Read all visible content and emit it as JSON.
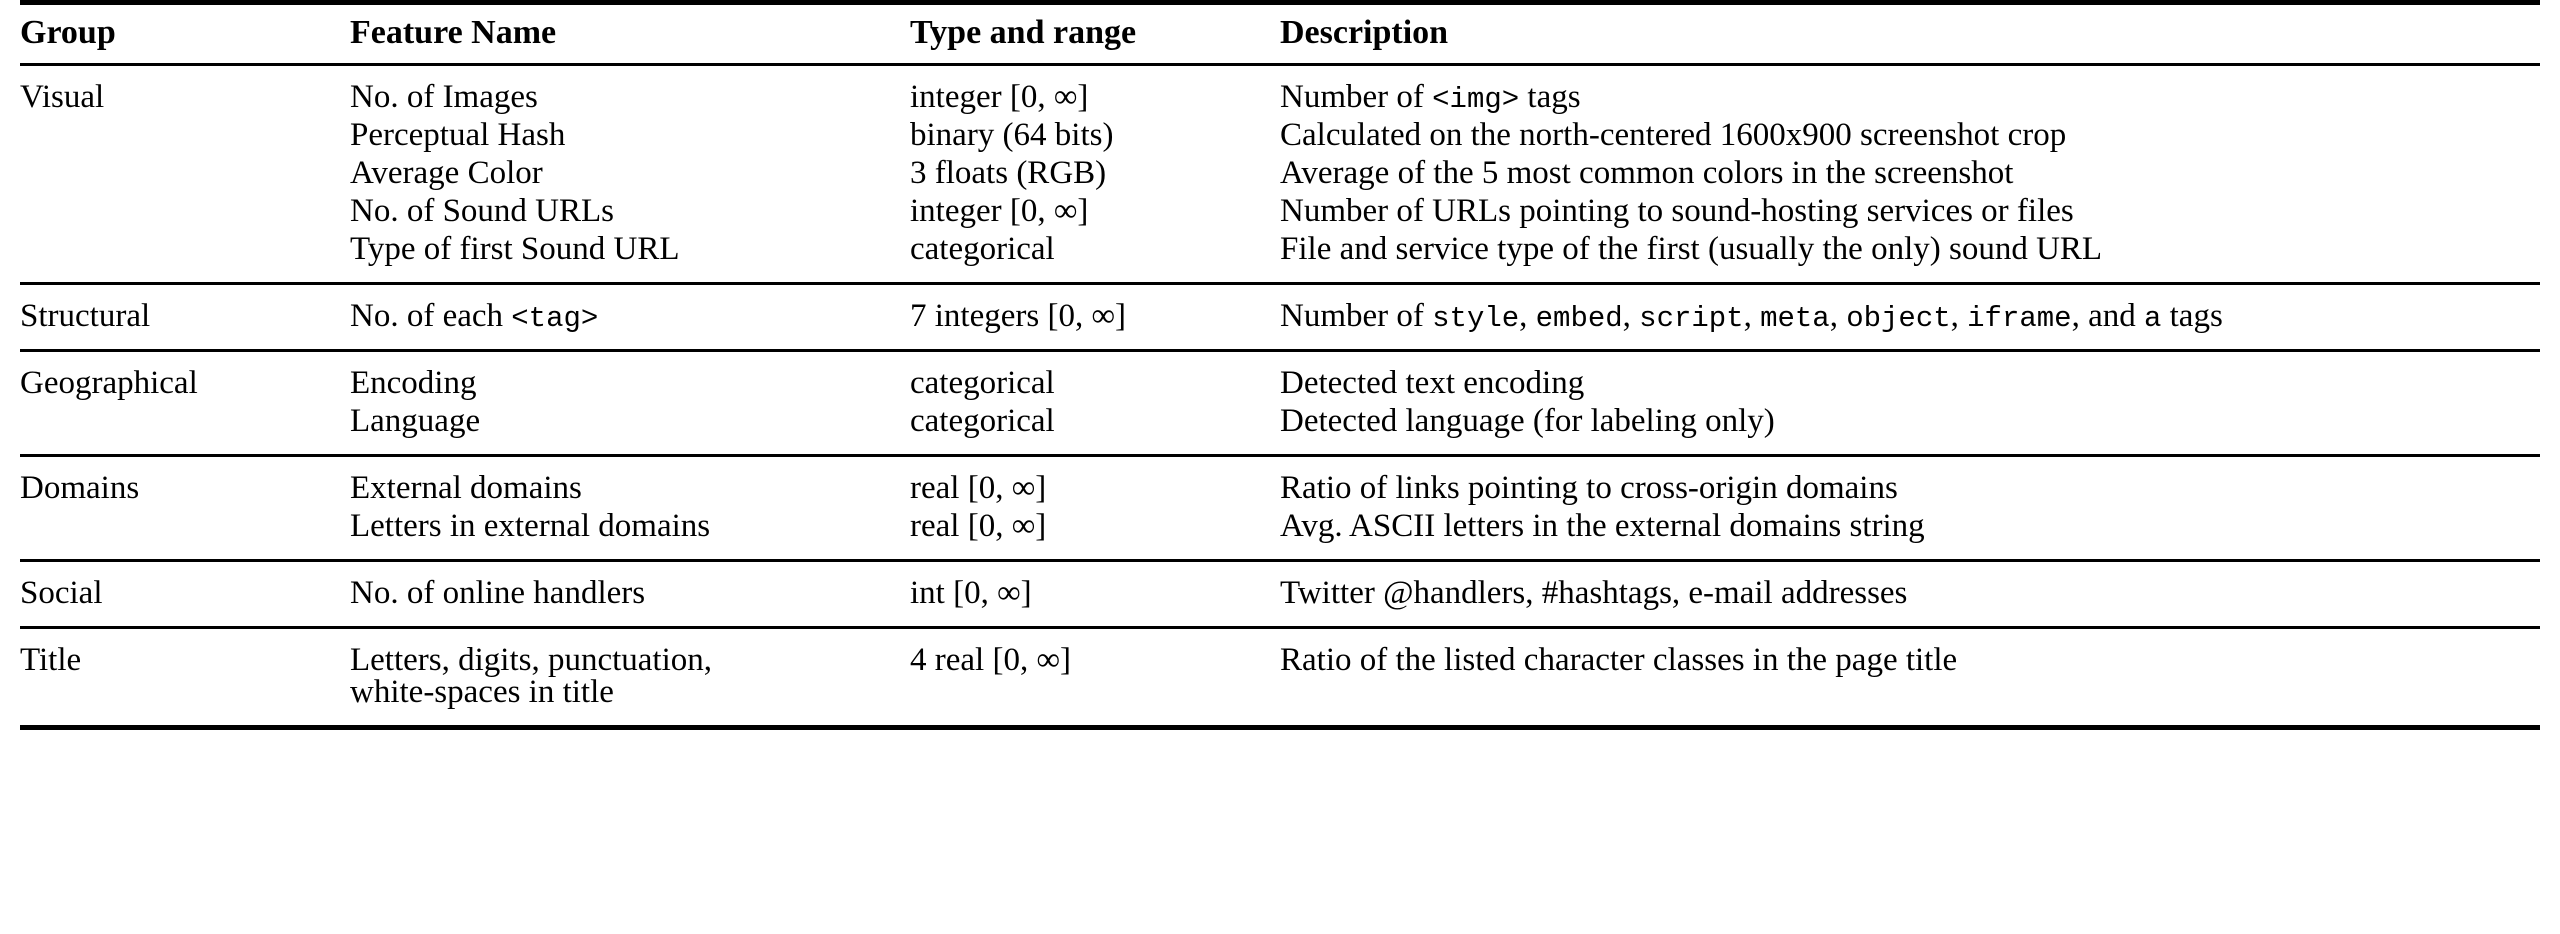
{
  "table": {
    "columns": [
      {
        "key": "group",
        "label": "Group"
      },
      {
        "key": "name",
        "label": "Feature Name"
      },
      {
        "key": "type",
        "label": "Type and range"
      },
      {
        "key": "desc",
        "label": "Description"
      }
    ],
    "groups": [
      {
        "group": "Visual",
        "rows": [
          {
            "name": "No. of Images",
            "type": "integer [0, ∞]",
            "desc_pre": "Number of ",
            "desc_mono": "<img>",
            "desc_post": " tags"
          },
          {
            "name": "Perceptual Hash",
            "type": "binary (64 bits)",
            "desc": "Calculated on the north-centered 1600x900 screenshot crop"
          },
          {
            "name": "Average Color",
            "type": "3 floats (RGB)",
            "desc": "Average of the 5 most common colors in the screenshot"
          },
          {
            "name": "No. of Sound URLs",
            "type": "integer [0, ∞]",
            "desc": "Number of URLs pointing to sound-hosting services or files"
          },
          {
            "name": "Type of first Sound URL",
            "type": "categorical",
            "desc": "File and service type of the first (usually the only) sound URL"
          }
        ]
      },
      {
        "group": "Structural",
        "rows": [
          {
            "name_pre": "No. of each ",
            "name_mono": "<tag>",
            "type": "7 integers [0, ∞]",
            "desc_parts": [
              {
                "text": "Number of ",
                "mono": false
              },
              {
                "text": "style",
                "mono": true
              },
              {
                "text": ", ",
                "mono": false
              },
              {
                "text": "embed",
                "mono": true
              },
              {
                "text": ", ",
                "mono": false
              },
              {
                "text": "script",
                "mono": true
              },
              {
                "text": ", ",
                "mono": false
              },
              {
                "text": "meta",
                "mono": true
              },
              {
                "text": ", ",
                "mono": false
              },
              {
                "text": "object",
                "mono": true
              },
              {
                "text": ", ",
                "mono": false
              },
              {
                "text": "iframe",
                "mono": true
              },
              {
                "text": ", and ",
                "mono": false
              },
              {
                "text": "a",
                "mono": true
              },
              {
                "text": " tags",
                "mono": false
              }
            ]
          }
        ]
      },
      {
        "group": "Geographical",
        "rows": [
          {
            "name": "Encoding",
            "type": "categorical",
            "desc": "Detected text encoding"
          },
          {
            "name": "Language",
            "type": "categorical",
            "desc": "Detected language (for labeling only)"
          }
        ]
      },
      {
        "group": "Domains",
        "rows": [
          {
            "name": "External domains",
            "type": "real [0, ∞]",
            "desc": "Ratio of links pointing to cross-origin domains"
          },
          {
            "name": "Letters in external domains",
            "type": "real [0, ∞]",
            "desc": "Avg. ASCII letters in the external domains string"
          }
        ]
      },
      {
        "group": "Social",
        "rows": [
          {
            "name": "No. of online handlers",
            "type": "int [0, ∞]",
            "desc": "Twitter @handlers, #hashtags, e-mail addresses"
          }
        ]
      },
      {
        "group": "Title",
        "rows": [
          {
            "name_line1": "Letters, digits, punctuation,",
            "name_line2": "white-spaces in title",
            "type": "4 real [0, ∞]",
            "desc": "Ratio of the listed character classes in the page title"
          }
        ]
      }
    ]
  },
  "colors": {
    "text": "#000000",
    "rule": "#000000",
    "background": "#ffffff"
  }
}
